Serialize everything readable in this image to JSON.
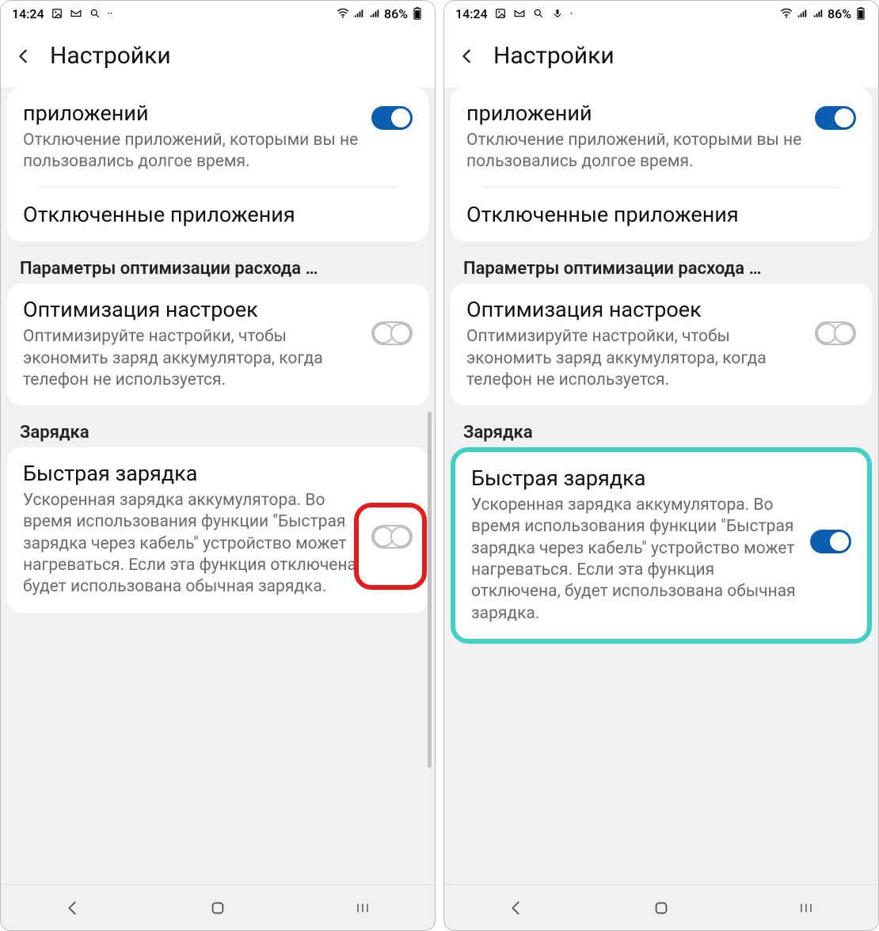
{
  "screens": [
    {
      "statusbar": {
        "time": "14:24",
        "battery": "86%",
        "icons": [
          "image",
          "gmail",
          "search",
          "more"
        ],
        "right_icons": [
          "wifi",
          "signal",
          "signal",
          "battery"
        ]
      },
      "header": {
        "title": "Настройки"
      },
      "apps": {
        "title": "приложений",
        "desc": "Отключение приложений, которыми вы не пользовались долгое время.",
        "on": true
      },
      "disabled_apps": {
        "title": "Отключенные приложения"
      },
      "section_opt": "Параметры оптимизации расхода …",
      "optimize": {
        "title": "Оптимизация настроек",
        "desc": "Оптимизируйте настройки, чтобы экономить заряд аккумулятора, когда телефон не используется.",
        "on": false
      },
      "section_charge": "Зарядка",
      "fast": {
        "title": "Быстрая зарядка",
        "desc": "Ускоренная зарядка аккумулятора. Во время использования функции \"Быстрая зарядка через кабель\" устройство может нагреваться. Если эта функция отключена, будет использована обычная зарядка.",
        "on": false,
        "highlight": "red-circle-on-toggle"
      }
    },
    {
      "statusbar": {
        "time": "14:24",
        "battery": "86%",
        "icons": [
          "image",
          "gmail",
          "search",
          "mic",
          "more"
        ],
        "right_icons": [
          "wifi",
          "signal",
          "signal",
          "battery"
        ]
      },
      "header": {
        "title": "Настройки"
      },
      "apps": {
        "title": "приложений",
        "desc": "Отключение приложений, которыми вы не пользовались долгое время.",
        "on": true
      },
      "disabled_apps": {
        "title": "Отключенные приложения"
      },
      "section_opt": "Параметры оптимизации расхода …",
      "optimize": {
        "title": "Оптимизация настроек",
        "desc": "Оптимизируйте настройки, чтобы экономить заряд аккумулятора, когда телефон не используется.",
        "on": false
      },
      "section_charge": "Зарядка",
      "fast": {
        "title": "Быстрая зарядка",
        "desc": "Ускоренная зарядка аккумулятора. Во время использования функции \"Быстрая зарядка через кабель\" устройство может нагреваться. Если эта функция отключена, будет использована обычная зарядка.",
        "on": true,
        "highlight": "teal-box-on-card"
      }
    }
  ]
}
